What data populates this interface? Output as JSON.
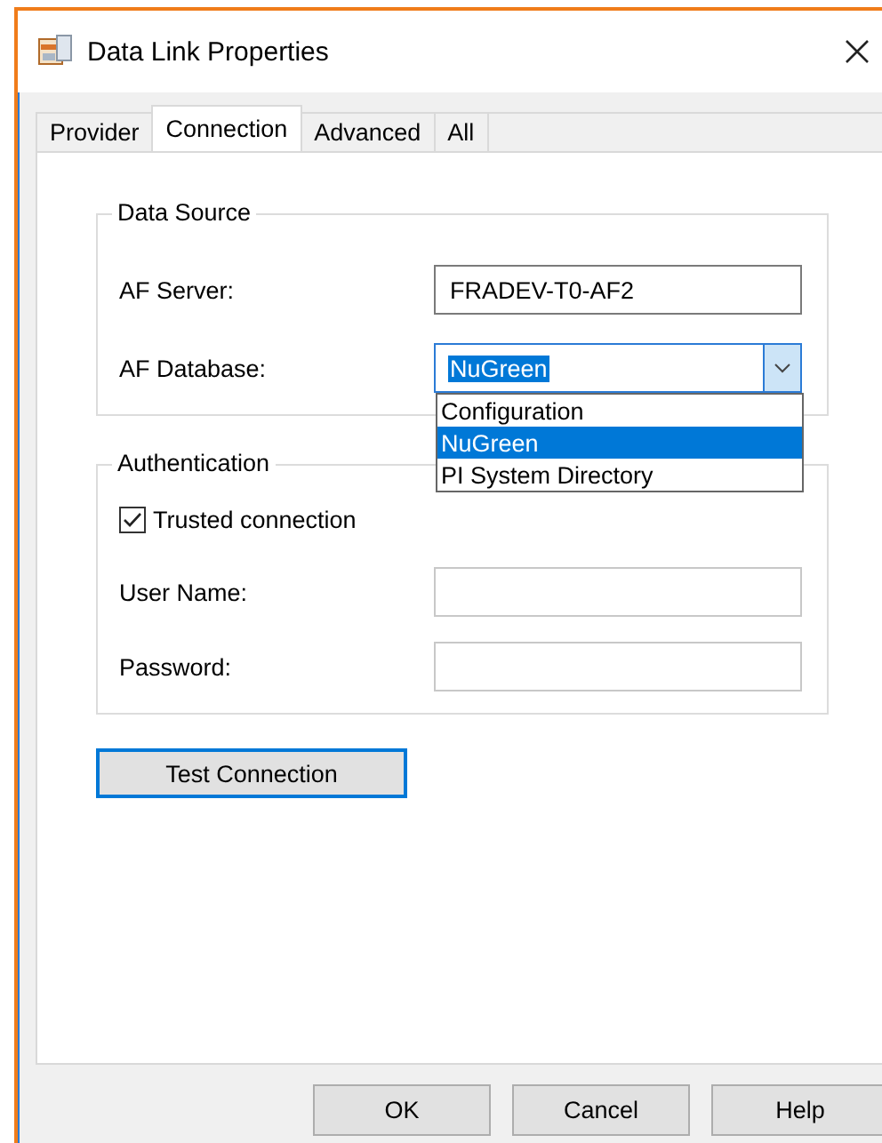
{
  "window": {
    "title": "Data Link Properties"
  },
  "tabs": [
    {
      "label": "Provider",
      "selected": false
    },
    {
      "label": "Connection",
      "selected": true
    },
    {
      "label": "Advanced",
      "selected": false
    },
    {
      "label": "All",
      "selected": false
    }
  ],
  "data_source": {
    "title": "Data Source",
    "fields": [
      {
        "label": "AF Server:",
        "kind": "text",
        "value": "FRADEV-T0-AF2"
      },
      {
        "label": "AF Database:",
        "kind": "combo",
        "value": "NuGreen",
        "expanded": true,
        "options": [
          {
            "label": "Configuration",
            "selected": false
          },
          {
            "label": "NuGreen",
            "selected": true
          },
          {
            "label": "PI System Directory",
            "selected": false
          }
        ]
      }
    ]
  },
  "authentication": {
    "title": "Authentication",
    "trusted_connection": {
      "label": "Trusted connection",
      "checked": true
    },
    "fields": [
      {
        "label": "User Name:",
        "kind": "text"
      },
      {
        "label": "Password:",
        "kind": "text"
      }
    ]
  },
  "test_button": "Test Connection",
  "buttons": [
    "OK",
    "Cancel",
    "Help"
  ]
}
